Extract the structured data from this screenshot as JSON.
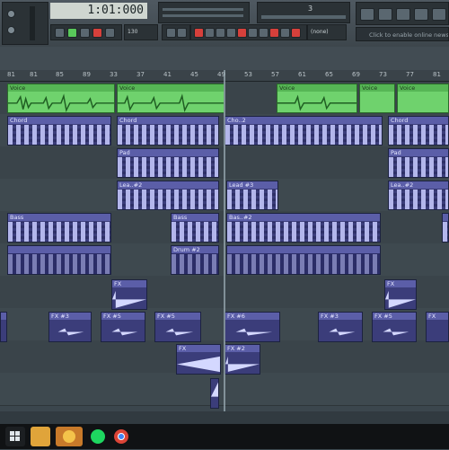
{
  "toolbar": {
    "time_display": "1:01:000",
    "pattern_number": "3",
    "tempo_value": "130",
    "snap_value": "(none)",
    "news_text": "Click to enable online news"
  },
  "ruler": {
    "bars": [
      "81",
      "85",
      "89",
      "33",
      "37",
      "41",
      "45",
      "49",
      "53",
      "57",
      "61",
      "65",
      "69",
      "73",
      "77",
      "81"
    ]
  },
  "playlist": {
    "clips": {
      "voice": "Voice",
      "chord": "Chord",
      "chord_short": "Cho..2",
      "pad": "Pad",
      "lead": "Lea..#2",
      "lead3": "Lead #3",
      "bass": "Bass",
      "bass2": "Bas..#2",
      "drum2": "Drum #2",
      "fx": "FX",
      "fx2": "FX #2",
      "fx3": "FX #3",
      "fx5": "FX #5",
      "fx6": "FX #6"
    }
  },
  "colors": {
    "audio_clip": "#6fd26d",
    "pattern_clip": "#3b3d7a",
    "toolbar_bg": "#4a545b"
  },
  "taskbar": {
    "icons": [
      "windows-icon",
      "file-explorer-icon",
      "fl-studio-icon",
      "spotify-icon",
      "chrome-icon"
    ]
  }
}
